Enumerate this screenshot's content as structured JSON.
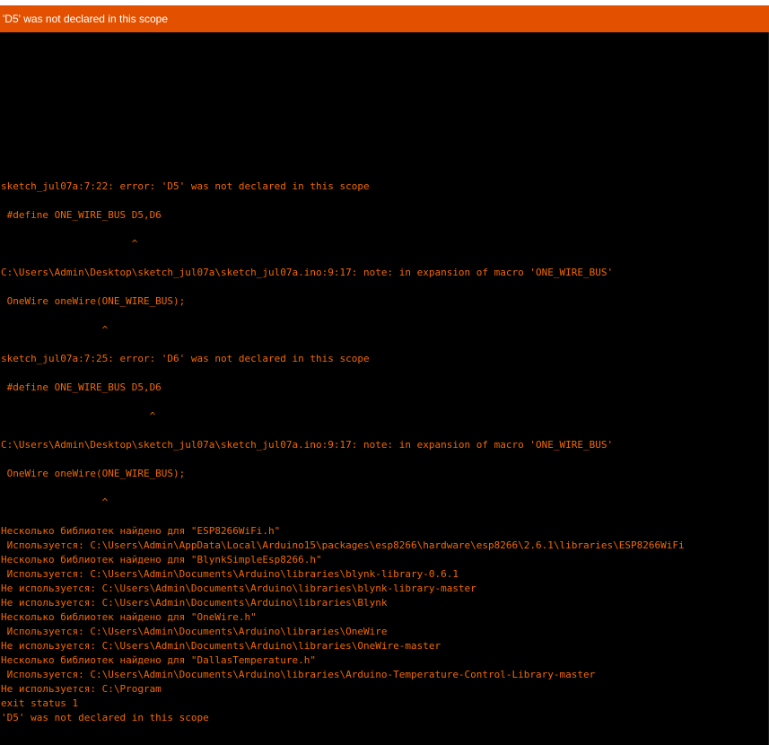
{
  "status_bar": {
    "message": "'D5' was not declared in this scope",
    "color": "#e35100"
  },
  "console": {
    "text_color": "#f26800",
    "background": "#000000",
    "lines": [
      "sketch_jul07a:7:22: error: 'D5' was not declared in this scope",
      "",
      " #define ONE_WIRE_BUS D5,D6",
      "",
      "                      ^",
      "",
      "C:\\Users\\Admin\\Desktop\\sketch_jul07a\\sketch_jul07a.ino:9:17: note: in expansion of macro 'ONE_WIRE_BUS'",
      "",
      " OneWire oneWire(ONE_WIRE_BUS);",
      "",
      "                 ^",
      "",
      "sketch_jul07a:7:25: error: 'D6' was not declared in this scope",
      "",
      " #define ONE_WIRE_BUS D5,D6",
      "",
      "                         ^",
      "",
      "C:\\Users\\Admin\\Desktop\\sketch_jul07a\\sketch_jul07a.ino:9:17: note: in expansion of macro 'ONE_WIRE_BUS'",
      "",
      " OneWire oneWire(ONE_WIRE_BUS);",
      "",
      "                 ^",
      "",
      "Несколько библиотек найдено для \"ESP8266WiFi.h\"",
      " Используется: C:\\Users\\Admin\\AppData\\Local\\Arduino15\\packages\\esp8266\\hardware\\esp8266\\2.6.1\\libraries\\ESP8266WiFi",
      "Несколько библиотек найдено для \"BlynkSimpleEsp8266.h\"",
      " Используется: C:\\Users\\Admin\\Documents\\Arduino\\libraries\\blynk-library-0.6.1",
      "Не используется: C:\\Users\\Admin\\Documents\\Arduino\\libraries\\blynk-library-master",
      "Не используется: C:\\Users\\Admin\\Documents\\Arduino\\libraries\\Blynk",
      "Несколько библиотек найдено для \"OneWire.h\"",
      " Используется: C:\\Users\\Admin\\Documents\\Arduino\\libraries\\OneWire",
      "Не используется: C:\\Users\\Admin\\Documents\\Arduino\\libraries\\OneWire-master",
      "Несколько библиотек найдено для \"DallasTemperature.h\"",
      " Используется: C:\\Users\\Admin\\Documents\\Arduino\\libraries\\Arduino-Temperature-Control-Library-master",
      "Не используется: C:\\Program",
      "exit status 1",
      "'D5' was not declared in this scope"
    ]
  }
}
